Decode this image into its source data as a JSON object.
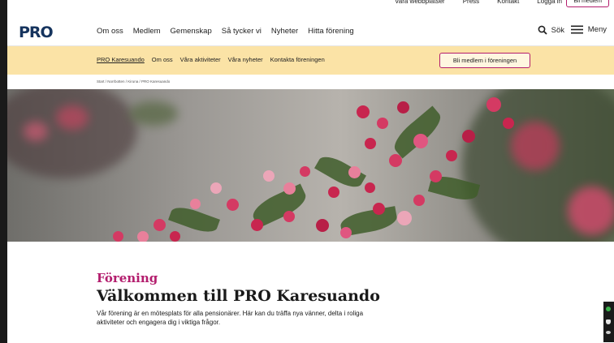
{
  "utility": {
    "links": [
      "Vara webbplatser",
      "Press",
      "Kontakt",
      "Logga in"
    ],
    "member_button": "Bli medlem"
  },
  "header": {
    "logo": "PRO",
    "nav": [
      "Om oss",
      "Medlem",
      "Gemenskap",
      "Så tycker vi",
      "Nyheter",
      "Hitta förening"
    ],
    "search_label": "Sök",
    "menu_label": "Meny"
  },
  "local_nav": {
    "items": [
      "PRO Karesuando",
      "Om oss",
      "Våra aktiviteter",
      "Våra nyheter",
      "Kontakta föreningen"
    ],
    "join_button": "Bli medlem i föreningen"
  },
  "breadcrumb": "Start / Norrbotten / Kiruna / PRO Karesuando",
  "hero": {
    "alt": "Rosa blomknoppar på en gren"
  },
  "content": {
    "eyebrow": "Förening",
    "title": "Välkommen till PRO Karesuando",
    "intro": "Vår förening är en mötesplats för alla pensionärer. Här kan du träffa nya vänner, delta i roliga aktiviteter och engagera dig i viktiga frågor."
  },
  "colors": {
    "brand_navy": "#16345e",
    "accent_magenta": "#b31d6d",
    "local_nav_bg": "#fbe3a6"
  },
  "icons": [
    "search-icon",
    "menu-icon"
  ]
}
